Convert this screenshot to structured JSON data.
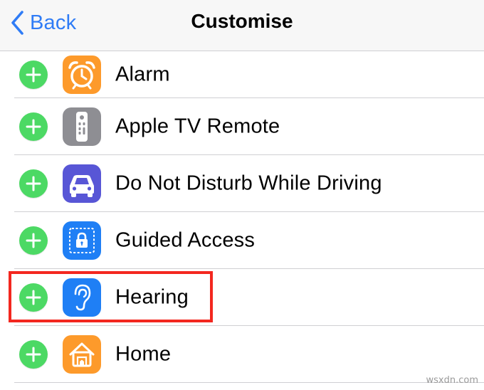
{
  "navbar": {
    "back_label": "Back",
    "title": "Customise"
  },
  "colors": {
    "accent": "#2f7cf6",
    "add_button": "#4cd964",
    "highlight": "#f3271f"
  },
  "controls": [
    {
      "label": "Alarm",
      "icon": "alarm-clock-icon",
      "icon_bg": "#fd9a2b",
      "action": "add"
    },
    {
      "label": "Apple TV Remote",
      "icon": "tv-remote-icon",
      "icon_bg": "#8e8e93",
      "action": "add"
    },
    {
      "label": "Do Not Disturb While Driving",
      "icon": "car-icon",
      "icon_bg": "#5856d6",
      "action": "add"
    },
    {
      "label": "Guided Access",
      "icon": "guided-access-lock-icon",
      "icon_bg": "#1f7ff5",
      "action": "add"
    },
    {
      "label": "Hearing",
      "icon": "ear-icon",
      "icon_bg": "#1f7ff5",
      "action": "add",
      "highlighted": true
    },
    {
      "label": "Home",
      "icon": "home-icon",
      "icon_bg": "#fd9a2b",
      "action": "add"
    }
  ],
  "watermark": "wsxdn.com"
}
